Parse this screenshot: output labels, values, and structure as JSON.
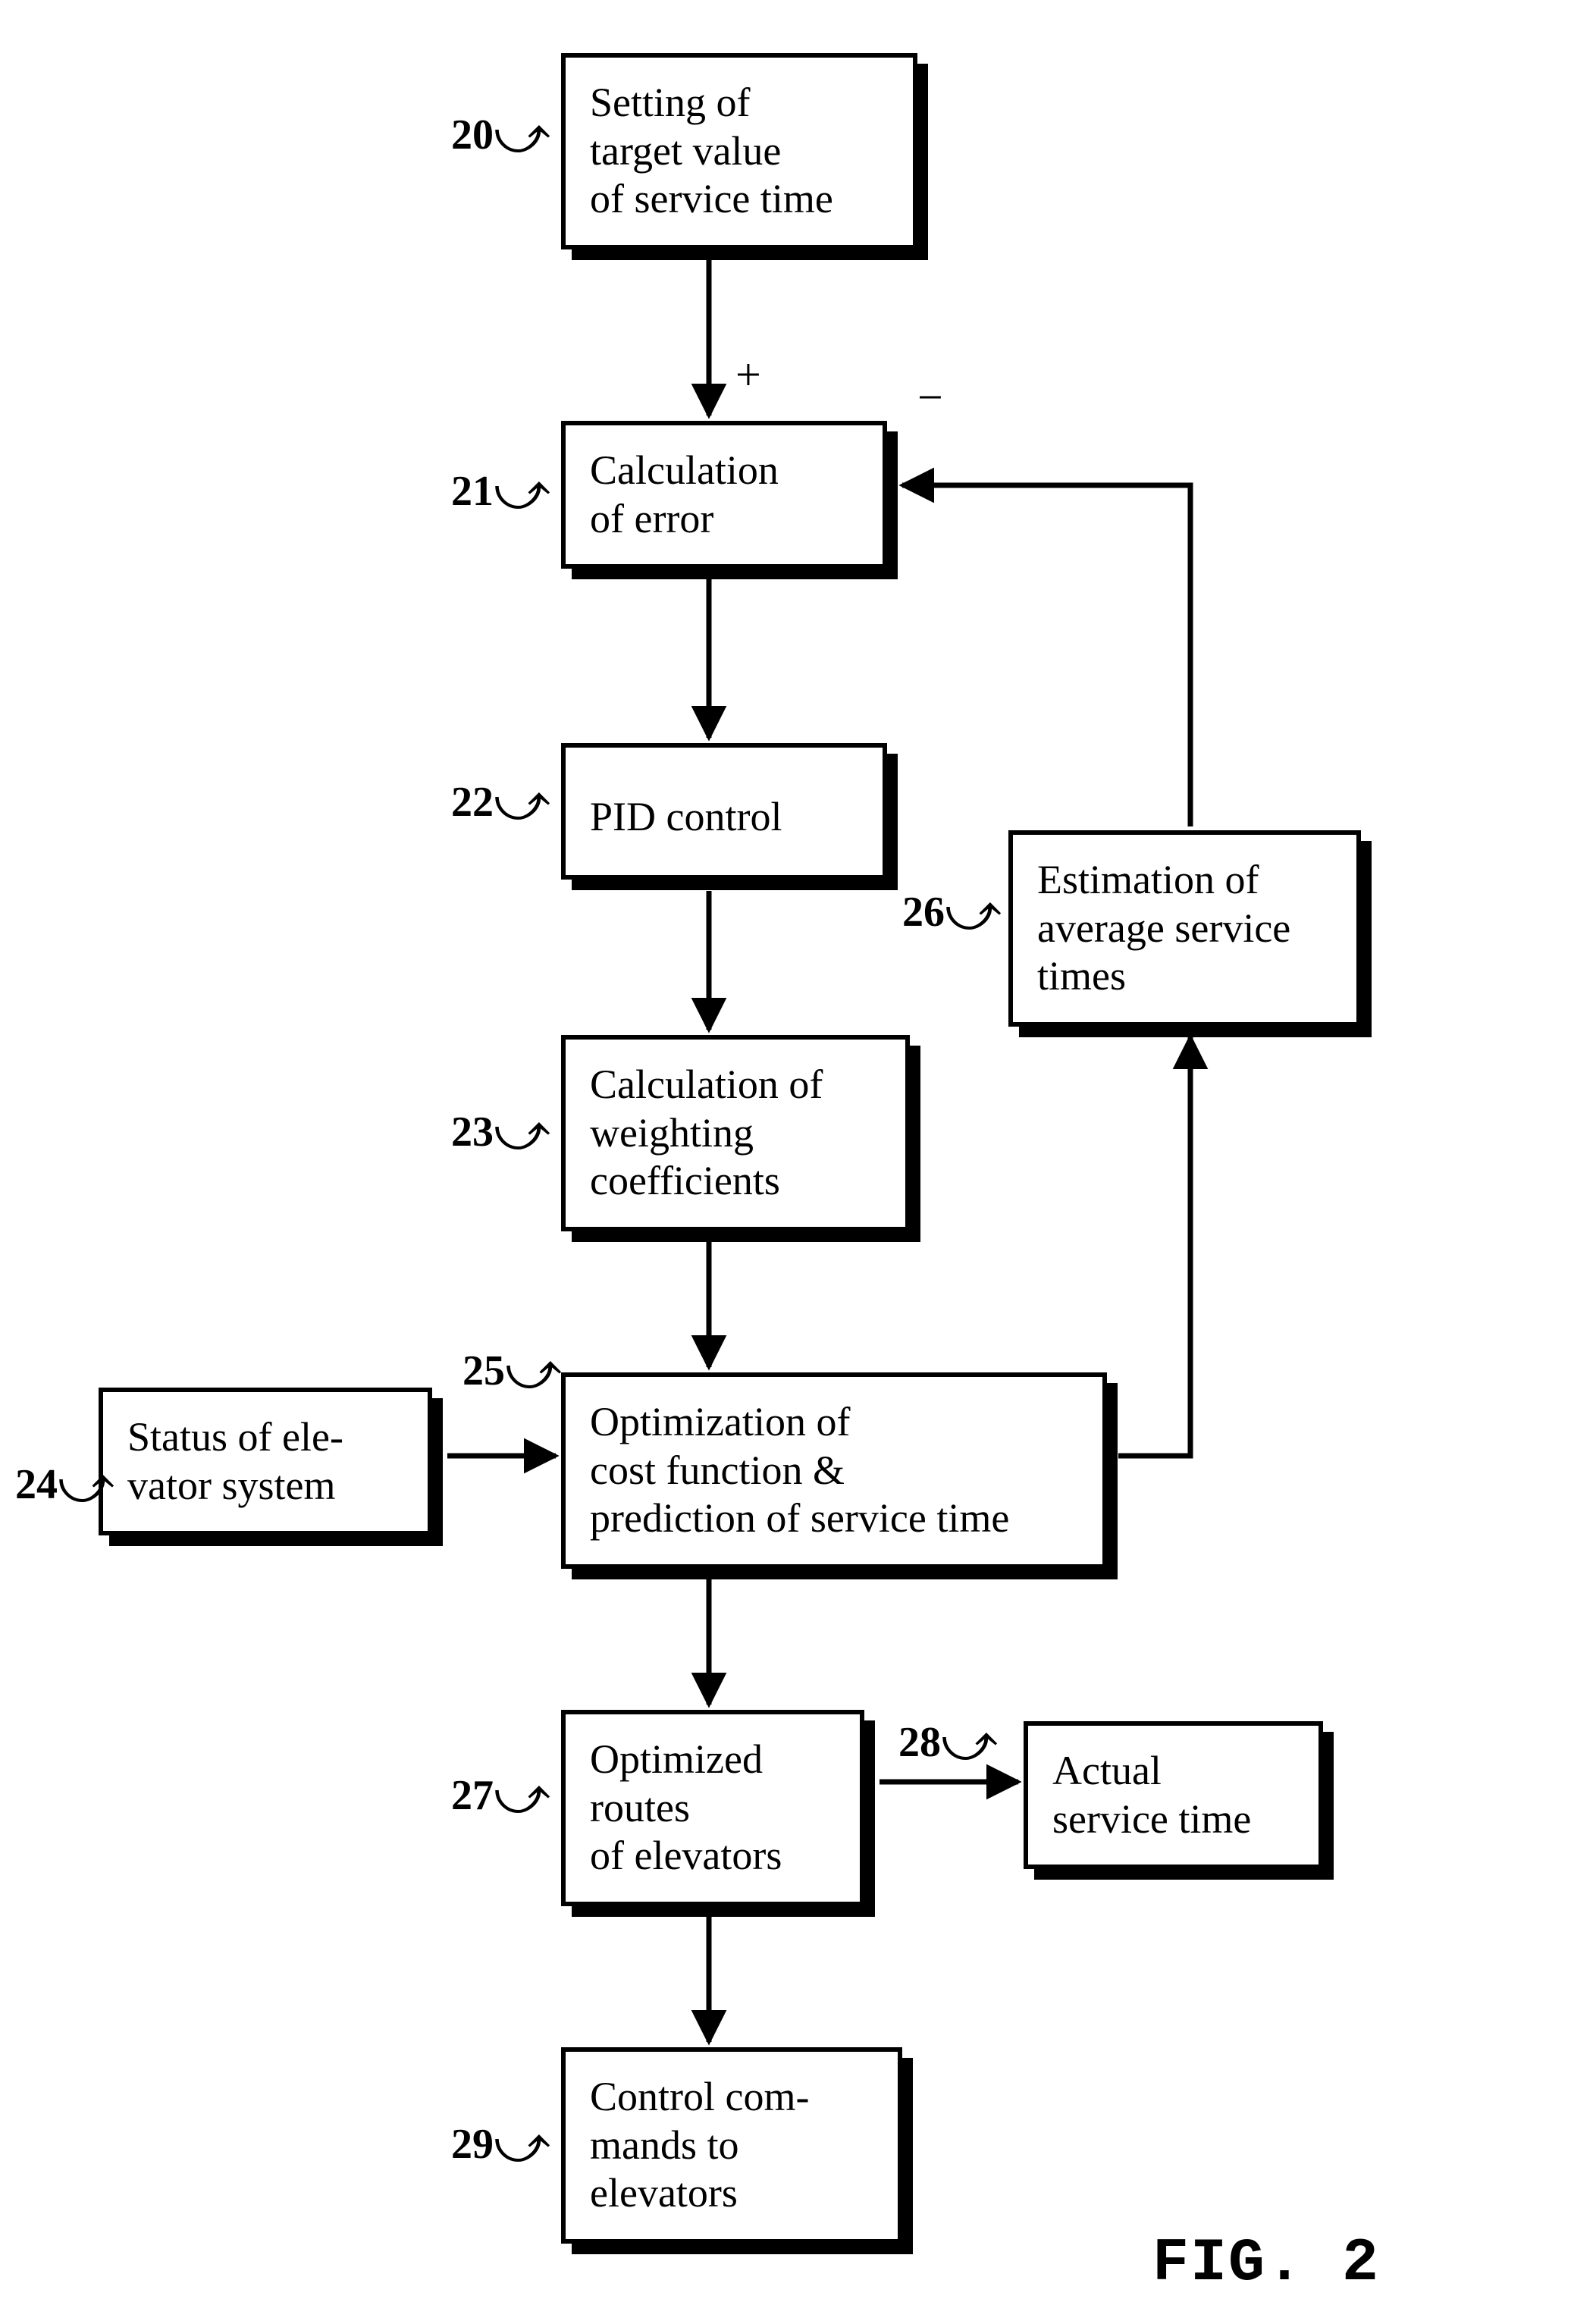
{
  "figure_label": "FIG. 2",
  "signs": {
    "plus": "+",
    "minus": "−"
  },
  "boxes": {
    "b20": {
      "ref": "20",
      "text": "Setting of\ntarget value\nof service time"
    },
    "b21": {
      "ref": "21",
      "text": "Calculation\nof error"
    },
    "b22": {
      "ref": "22",
      "text": "PID control"
    },
    "b23": {
      "ref": "23",
      "text": "Calculation of\nweighting\ncoefficients"
    },
    "b24": {
      "ref": "24",
      "text": "Status of ele-\nvator system"
    },
    "b25": {
      "ref": "25",
      "text": "Optimization of\ncost function &\nprediction of service time"
    },
    "b26": {
      "ref": "26",
      "text": "Estimation of\naverage service\ntimes"
    },
    "b27": {
      "ref": "27",
      "text": "Optimized\nroutes\nof elevators"
    },
    "b28": {
      "ref": "28",
      "text": "Actual\nservice time"
    },
    "b29": {
      "ref": "29",
      "text": "Control com-\nmands to\nelevators"
    }
  }
}
